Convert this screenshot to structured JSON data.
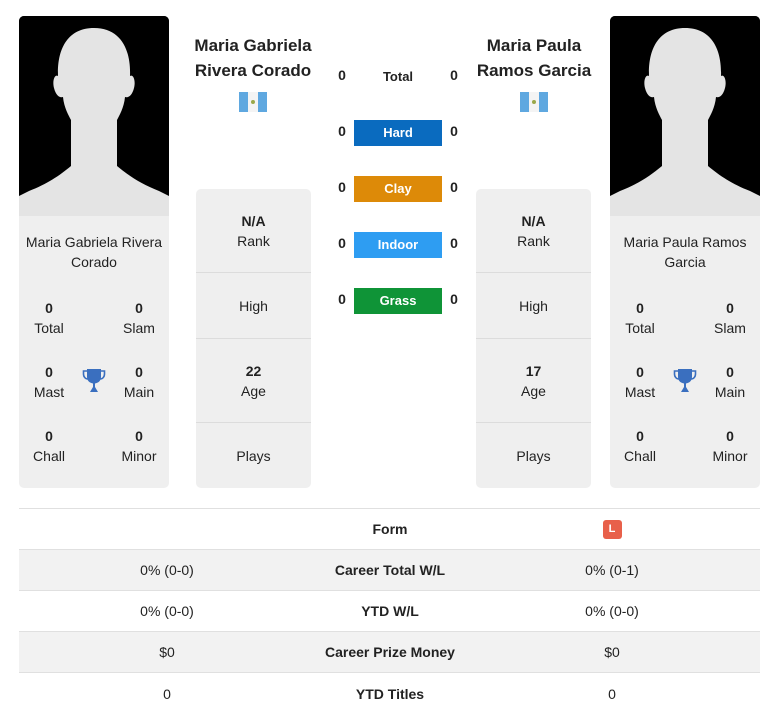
{
  "player1": {
    "name": "Maria Gabriela Rivera Corado",
    "header_name_line1": "Maria Gabriela",
    "header_name_line2": "Rivera Corado",
    "card_name": "Maria Gabriela Rivera Corado",
    "flag": "guatemala-flag",
    "titles": {
      "total": {
        "value": "0",
        "label": "Total"
      },
      "slam": {
        "value": "0",
        "label": "Slam"
      },
      "mast": {
        "value": "0",
        "label": "Mast"
      },
      "main": {
        "value": "0",
        "label": "Main"
      },
      "chall": {
        "value": "0",
        "label": "Chall"
      },
      "minor": {
        "value": "0",
        "label": "Minor"
      }
    },
    "info": {
      "rank": {
        "value": "N/A",
        "label": "Rank"
      },
      "high": {
        "value": "",
        "label": "High"
      },
      "age": {
        "value": "22",
        "label": "Age"
      },
      "plays": {
        "value": "",
        "label": "Plays"
      }
    }
  },
  "player2": {
    "name": "Maria Paula Ramos Garcia",
    "header_name_line1": "Maria Paula",
    "header_name_line2": "Ramos Garcia",
    "card_name": "Maria Paula Ramos Garcia",
    "flag": "guatemala-flag",
    "titles": {
      "total": {
        "value": "0",
        "label": "Total"
      },
      "slam": {
        "value": "0",
        "label": "Slam"
      },
      "mast": {
        "value": "0",
        "label": "Mast"
      },
      "main": {
        "value": "0",
        "label": "Main"
      },
      "chall": {
        "value": "0",
        "label": "Chall"
      },
      "minor": {
        "value": "0",
        "label": "Minor"
      }
    },
    "info": {
      "rank": {
        "value": "N/A",
        "label": "Rank"
      },
      "high": {
        "value": "",
        "label": "High"
      },
      "age": {
        "value": "17",
        "label": "Age"
      },
      "plays": {
        "value": "",
        "label": "Plays"
      }
    }
  },
  "h2h": {
    "total": {
      "label": "Total",
      "p1": "0",
      "p2": "0"
    },
    "surfaces": [
      {
        "label": "Hard",
        "p1": "0",
        "p2": "0",
        "color": "#0a6bbf"
      },
      {
        "label": "Clay",
        "p1": "0",
        "p2": "0",
        "color": "#dd8a08"
      },
      {
        "label": "Indoor",
        "p1": "0",
        "p2": "0",
        "color": "#2e9df2"
      },
      {
        "label": "Grass",
        "p1": "0",
        "p2": "0",
        "color": "#0f9437"
      }
    ]
  },
  "comparison": {
    "rows": [
      {
        "label": "Form",
        "p1": "",
        "p2_form": [
          "L"
        ]
      },
      {
        "label": "Career Total W/L",
        "p1": "0% (0-0)",
        "p2": "0% (0-1)"
      },
      {
        "label": "YTD W/L",
        "p1": "0% (0-0)",
        "p2": "0% (0-0)"
      },
      {
        "label": "Career Prize Money",
        "p1": "$0",
        "p2": "$0"
      },
      {
        "label": "YTD Titles",
        "p1": "0",
        "p2": "0"
      }
    ]
  },
  "colors": {
    "loss_badge": "#e8604a",
    "trophy": "#3a6fbf"
  }
}
